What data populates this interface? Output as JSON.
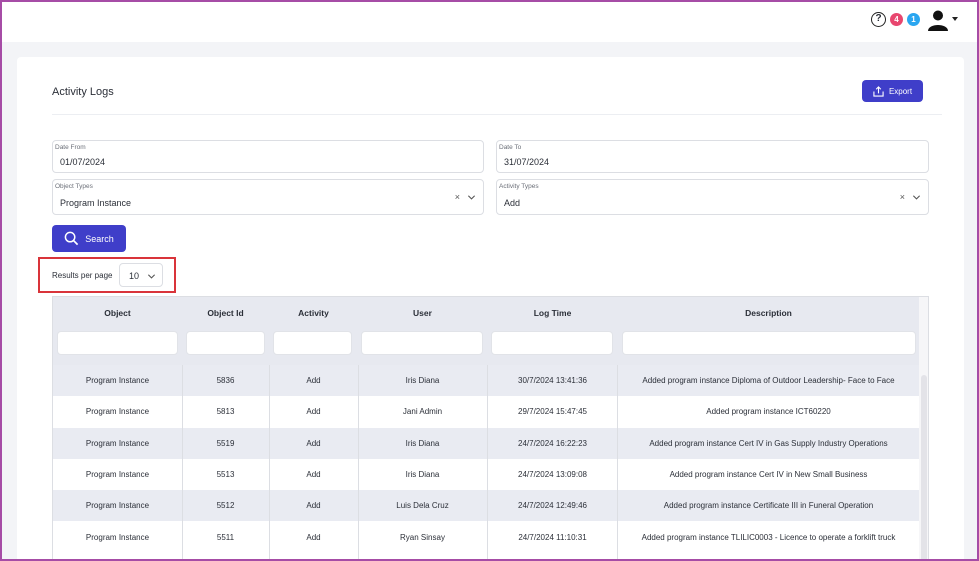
{
  "header": {
    "help_icon_glyph": "?",
    "notifications_count": "4",
    "messages_count": "1"
  },
  "page": {
    "title": "Activity Logs",
    "export_label": "Export"
  },
  "filters": {
    "date_from_label": "Date From",
    "date_from_value": "01/07/2024",
    "date_to_label": "Date To",
    "date_to_value": "31/07/2024",
    "object_types_label": "Object Types",
    "object_types_value": "Program Instance",
    "activity_types_label": "Activity Types",
    "activity_types_value": "Add",
    "clear_glyph": "×",
    "search_label": "Search"
  },
  "pagination": {
    "results_per_page_label": "Results per page",
    "results_per_page_value": "10"
  },
  "table": {
    "columns": [
      "Object",
      "Object Id",
      "Activity",
      "User",
      "Log Time",
      "Description"
    ],
    "rows": [
      [
        "Program Instance",
        "5836",
        "Add",
        "Iris Diana",
        "30/7/2024 13:41:36",
        "Added program instance Diploma of Outdoor Leadership- Face to Face"
      ],
      [
        "Program Instance",
        "5813",
        "Add",
        "Jani Admin",
        "29/7/2024 15:47:45",
        "Added program instance ICT60220"
      ],
      [
        "Program Instance",
        "5519",
        "Add",
        "Iris Diana",
        "24/7/2024 16:22:23",
        "Added program instance Cert IV in Gas Supply Industry Operations"
      ],
      [
        "Program Instance",
        "5513",
        "Add",
        "Iris Diana",
        "24/7/2024 13:09:08",
        "Added program instance Cert IV in New Small Business"
      ],
      [
        "Program Instance",
        "5512",
        "Add",
        "Luis Dela Cruz",
        "24/7/2024 12:49:46",
        "Added program instance Certificate III in Funeral Operation"
      ],
      [
        "Program Instance",
        "5511",
        "Add",
        "Ryan Sinsay",
        "24/7/2024 11:10:31",
        "Added program instance TLILIC0003 - Licence to operate a forklift truck"
      ]
    ]
  },
  "colors": {
    "primary": "#3f3ec9",
    "highlight": "#d9343a",
    "badge_red": "#e8466f",
    "badge_blue": "#2aa6f0"
  }
}
